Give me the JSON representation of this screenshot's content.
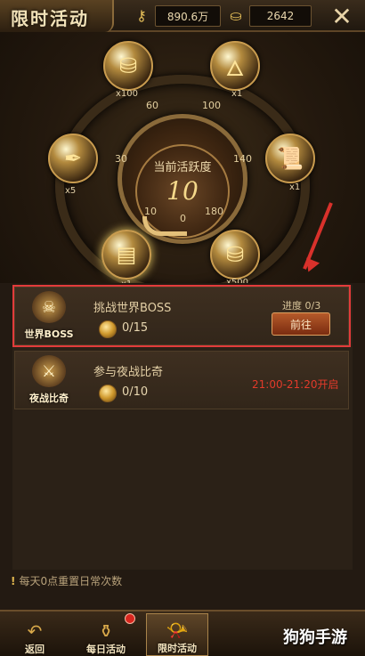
{
  "header": {
    "title": "限时活动",
    "resource1": {
      "icon": "key-coin-icon",
      "value": "890.6万"
    },
    "resource2": {
      "icon": "ingot-icon",
      "value": "2642"
    },
    "close_icon": "close-icon"
  },
  "dial": {
    "label": "当前活跃度",
    "active_value": "10",
    "progress_fraction": 0.06,
    "ticks": [
      "60",
      "100",
      "30",
      "140",
      "10",
      "0",
      "180"
    ],
    "rewards": [
      {
        "icon": "gold-ingot-pile-icon",
        "count": "x100",
        "highlight": false
      },
      {
        "icon": "fire-orb-icon",
        "count": "x1",
        "highlight": false
      },
      {
        "icon": "feather-icon",
        "count": "x5",
        "highlight": false
      },
      {
        "icon": "scroll-icon",
        "count": "x1",
        "highlight": false
      },
      {
        "icon": "gold-bars-icon",
        "count": "x1",
        "highlight": true
      },
      {
        "icon": "gold-ingot-pile-icon",
        "count": "x500",
        "highlight": false
      }
    ]
  },
  "activities": [
    {
      "icon_label": "世界BOSS",
      "name": "挑战世界BOSS",
      "count": "0/15",
      "progress": "进度 0/3",
      "button": "前往",
      "highlight": true
    },
    {
      "icon_label": "夜战比奇",
      "name": "参与夜战比奇",
      "count": "0/10",
      "time": "21:00-21:20开启",
      "highlight": false
    }
  ],
  "reset_note": "每天0点重置日常次数",
  "nav": {
    "back": "返回",
    "daily": "每日活动",
    "limited": "限时活动"
  },
  "watermark": "狗狗手游",
  "colors": {
    "highlight_red": "#e23b3b",
    "time_red": "#e23a2a",
    "gold": "#e3c07a"
  }
}
